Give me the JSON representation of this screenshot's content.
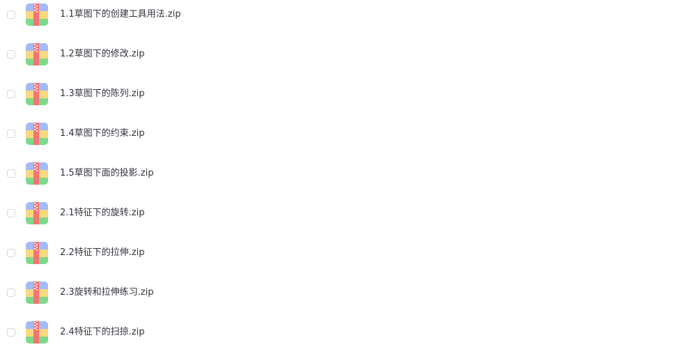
{
  "files": [
    {
      "name": "1.1草图下的创建工具用法.zip",
      "icon": "zip-archive-icon"
    },
    {
      "name": "1.2草图下的修改.zip",
      "icon": "zip-archive-icon"
    },
    {
      "name": "1.3草图下的陈列.zip",
      "icon": "zip-archive-icon"
    },
    {
      "name": "1.4草图下的约束.zip",
      "icon": "zip-archive-icon"
    },
    {
      "name": "1.5草图下面的投影.zip",
      "icon": "zip-archive-icon"
    },
    {
      "name": "2.1特征下的旋转.zip",
      "icon": "zip-archive-icon"
    },
    {
      "name": "2.2特征下的拉伸.zip",
      "icon": "zip-archive-icon"
    },
    {
      "name": "2.3旋转和拉伸练习.zip",
      "icon": "zip-archive-icon"
    },
    {
      "name": "2.4特征下的扫掠.zip",
      "icon": "zip-archive-icon"
    }
  ],
  "colors": {
    "icon_top": "#a4bbf8",
    "icon_middle": "#fbd87f",
    "icon_bottom": "#7fd98c",
    "icon_zipper": "#f27474",
    "text": "#30333a",
    "checkbox_border": "#d6d9df"
  }
}
